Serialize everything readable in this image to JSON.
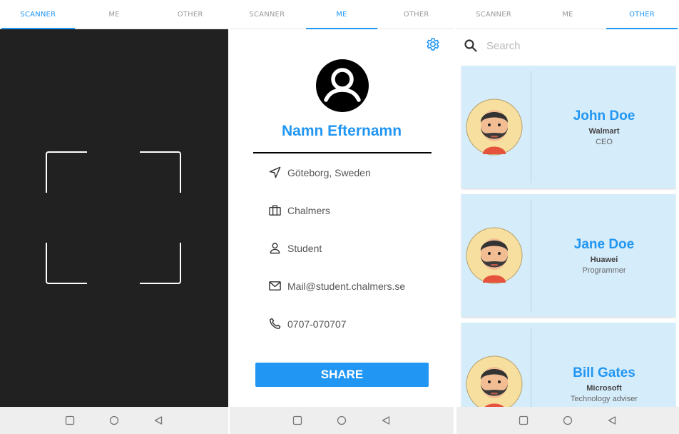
{
  "tabs": [
    "SCANNER",
    "ME",
    "OTHER"
  ],
  "me": {
    "name": "Namn Efternamn",
    "location": "Göteborg, Sweden",
    "organization": "Chalmers",
    "occupation": "Student",
    "email": "Mail@student.chalmers.se",
    "phone": "0707-070707",
    "share_label": "SHARE"
  },
  "other": {
    "search_placeholder": "Search",
    "contacts": [
      {
        "name": "John Doe",
        "company": "Walmart",
        "role": "CEO"
      },
      {
        "name": "Jane Doe",
        "company": "Huawei",
        "role": "Programmer"
      },
      {
        "name": "Bill Gates",
        "company": "Microsoft",
        "role": "Technology adviser"
      }
    ]
  },
  "colors": {
    "accent": "#2196F3",
    "camera_bg": "#212121",
    "card_bg": "#d5ecfb",
    "navbar_bg": "#eeeeee"
  }
}
